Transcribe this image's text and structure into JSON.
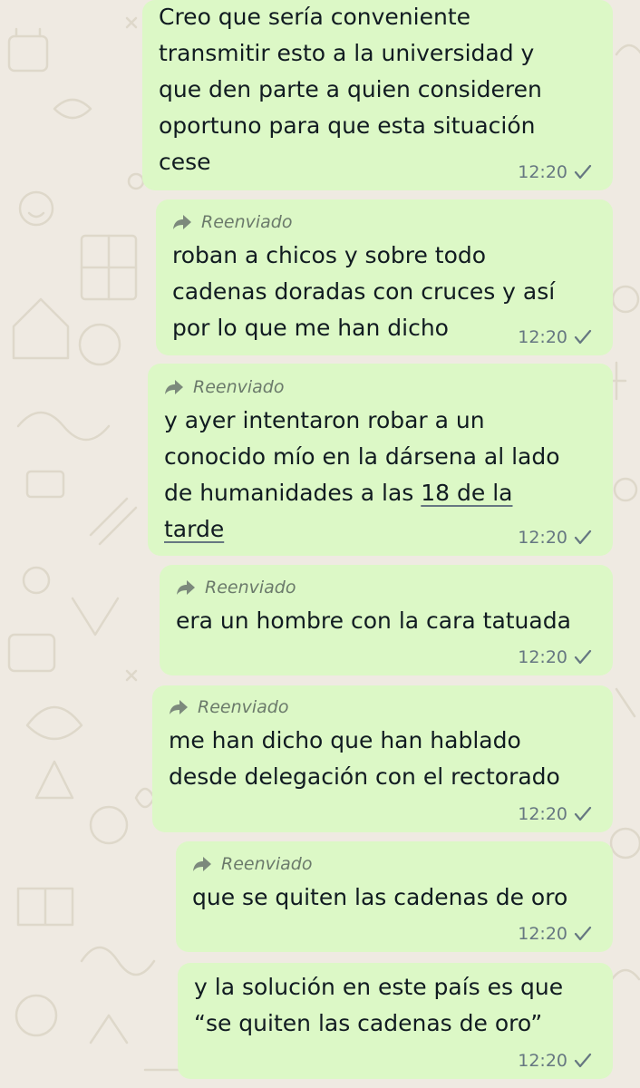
{
  "forwarded_label": "Reenviado",
  "messages": [
    {
      "text": "Creo que sería conveniente\ntransmitir esto a la universidad y\nque den parte a quien consideren\noportuno para que esta situación\ncese",
      "time": "12:20"
    },
    {
      "text": "roban a chicos y sobre todo\ncadenas doradas con cruces y así\npor lo que me han dicho",
      "time": "12:20"
    },
    {
      "text_before_link": "y ayer intentaron robar a un\nconocido mío en la dársena al lado\nde humanidades a las ",
      "link_text": "18 de la\ntarde",
      "time": "12:20"
    },
    {
      "text": "era un hombre con la cara tatuada",
      "time": "12:20"
    },
    {
      "text": "me han dicho que han hablado\ndesde delegación con el rectorado",
      "time": "12:20"
    },
    {
      "text": "que se quiten las cadenas de oro",
      "time": "12:20"
    },
    {
      "text": "y la solución en este país es que\n“se quiten las cadenas de oro”",
      "time": "12:20"
    }
  ],
  "icons": {
    "forward": "forward-arrow-icon",
    "status": "single-check-icon"
  },
  "colors": {
    "background": "#efeae2",
    "outgoing_bubble": "#dcf8c6",
    "meta_text": "#667781",
    "forwarded_text": "#6b7a6b"
  }
}
